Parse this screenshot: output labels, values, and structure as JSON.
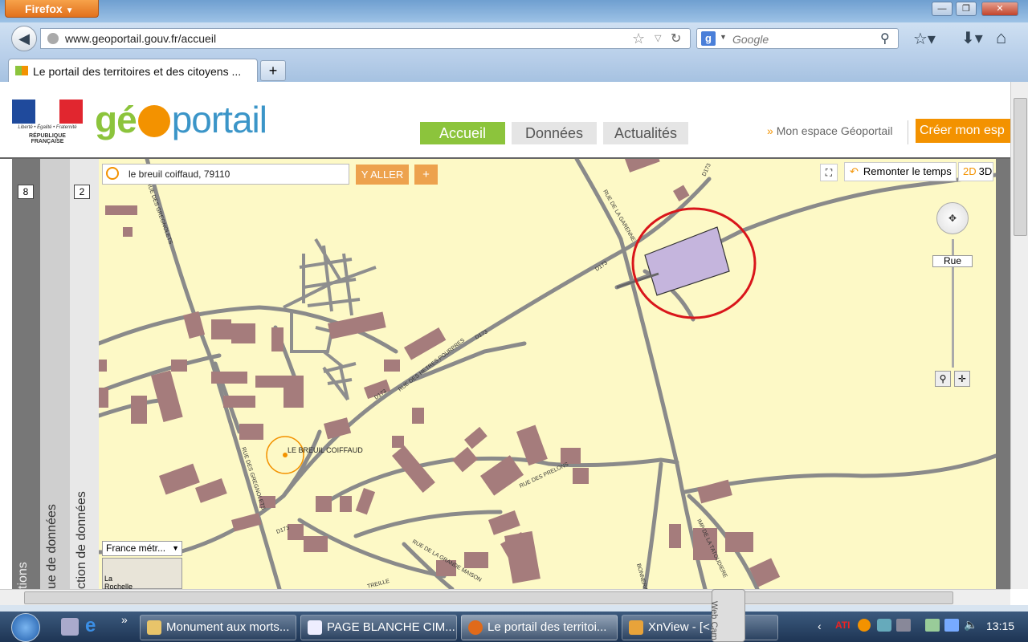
{
  "browser": {
    "app_button": "Firefox",
    "url": "www.geoportail.gouv.fr/accueil",
    "search_placeholder": "Google",
    "tab_title": "Le portail des territoires et des citoyens ..."
  },
  "site": {
    "brand": "géoportail",
    "nav_tabs": [
      "Accueil",
      "Données",
      "Actualités"
    ],
    "espace": "Mon espace Géoportail",
    "creer": "Créer mon esp",
    "marianne_caption": "Liberté • Égalité • Fraternité",
    "republique": "RÉPUBLIQUE FRANÇAISE"
  },
  "left_panels": {
    "count1": "8",
    "count2": "2",
    "label1": "tions",
    "label2": "ue de données",
    "label3": "ction de données"
  },
  "map": {
    "search_value": "le breuil coiffaud, 79110",
    "go_button": "Y ALLER",
    "plus_button": "+",
    "time_button": "Remonter le temps",
    "mode_2d": "2D",
    "mode_3d": "3D",
    "zoom_label": "Rue",
    "layer_select": "France métr...",
    "place_label": "LE BREUIL COIFFAUD",
    "minimap_label": "La Rochelle",
    "street_labels": {
      "gregnolets": "RUE DES GREGNOLETS",
      "hetres": "RUE DES HETRES POURPRES",
      "garenne": "RUE DE LA GARENNE",
      "prelons": "RUE DES PRELONS",
      "tatoudiere": "IMP DE LA TATOUDIERE",
      "grande_maison": "RUE DE LA GRANDE MAISON",
      "treille": "TREILLE",
      "bonnerie": "BONNERIE",
      "d173": "D173"
    }
  },
  "taskbar": {
    "items": [
      "Monument aux morts...",
      "PAGE BLANCHE CIM...",
      "Le portail des territoi...",
      "XnView - [<...>p..."
    ],
    "clock": "13:15",
    "webcam": "Web Cam"
  },
  "colors": {
    "accent_green": "#8cc43c",
    "accent_orange": "#eda24d",
    "building": "#a57c7c",
    "highlight_red": "#d9161b",
    "parcel_purple": "#c5b5dd",
    "map_bg": "#fdf9c6"
  }
}
